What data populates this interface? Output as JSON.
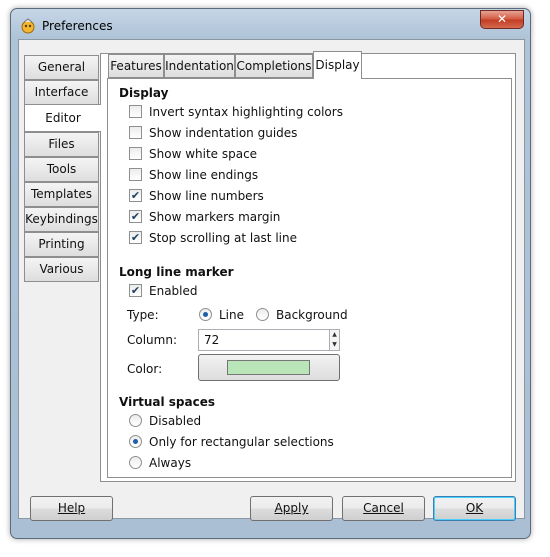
{
  "window": {
    "title": "Preferences",
    "close_glyph": "✕",
    "app_icon": "preferences-app-icon"
  },
  "side_tabs": [
    {
      "label": "General",
      "active": false
    },
    {
      "label": "Interface",
      "active": false
    },
    {
      "label": "Editor",
      "active": true
    },
    {
      "label": "Files",
      "active": false
    },
    {
      "label": "Tools",
      "active": false
    },
    {
      "label": "Templates",
      "active": false
    },
    {
      "label": "Keybindings",
      "active": false
    },
    {
      "label": "Printing",
      "active": false
    },
    {
      "label": "Various",
      "active": false
    }
  ],
  "top_tabs": [
    {
      "label": "Features",
      "active": false
    },
    {
      "label": "Indentation",
      "active": false
    },
    {
      "label": "Completions",
      "active": false
    },
    {
      "label": "Display",
      "active": true
    }
  ],
  "display": {
    "heading": "Display",
    "options": [
      {
        "label": "Invert syntax highlighting colors",
        "checked": false
      },
      {
        "label": "Show indentation guides",
        "checked": false
      },
      {
        "label": "Show white space",
        "checked": false
      },
      {
        "label": "Show line endings",
        "checked": false
      },
      {
        "label": "Show line numbers",
        "checked": true
      },
      {
        "label": "Show markers margin",
        "checked": true
      },
      {
        "label": "Stop scrolling at last line",
        "checked": true
      }
    ]
  },
  "long_line": {
    "heading": "Long line marker",
    "enabled_label": "Enabled",
    "enabled": true,
    "type_label": "Type:",
    "type_options": [
      {
        "label": "Line",
        "selected": true
      },
      {
        "label": "Background",
        "selected": false
      }
    ],
    "column_label": "Column:",
    "column_value": "72",
    "color_label": "Color:",
    "color_value": "#b9e5b9"
  },
  "virtual_spaces": {
    "heading": "Virtual spaces",
    "options": [
      {
        "label": "Disabled",
        "selected": false
      },
      {
        "label": "Only for rectangular selections",
        "selected": true
      },
      {
        "label": "Always",
        "selected": false
      }
    ]
  },
  "buttons": {
    "help": "Help",
    "apply": "Apply",
    "cancel": "Cancel",
    "ok": "OK"
  }
}
